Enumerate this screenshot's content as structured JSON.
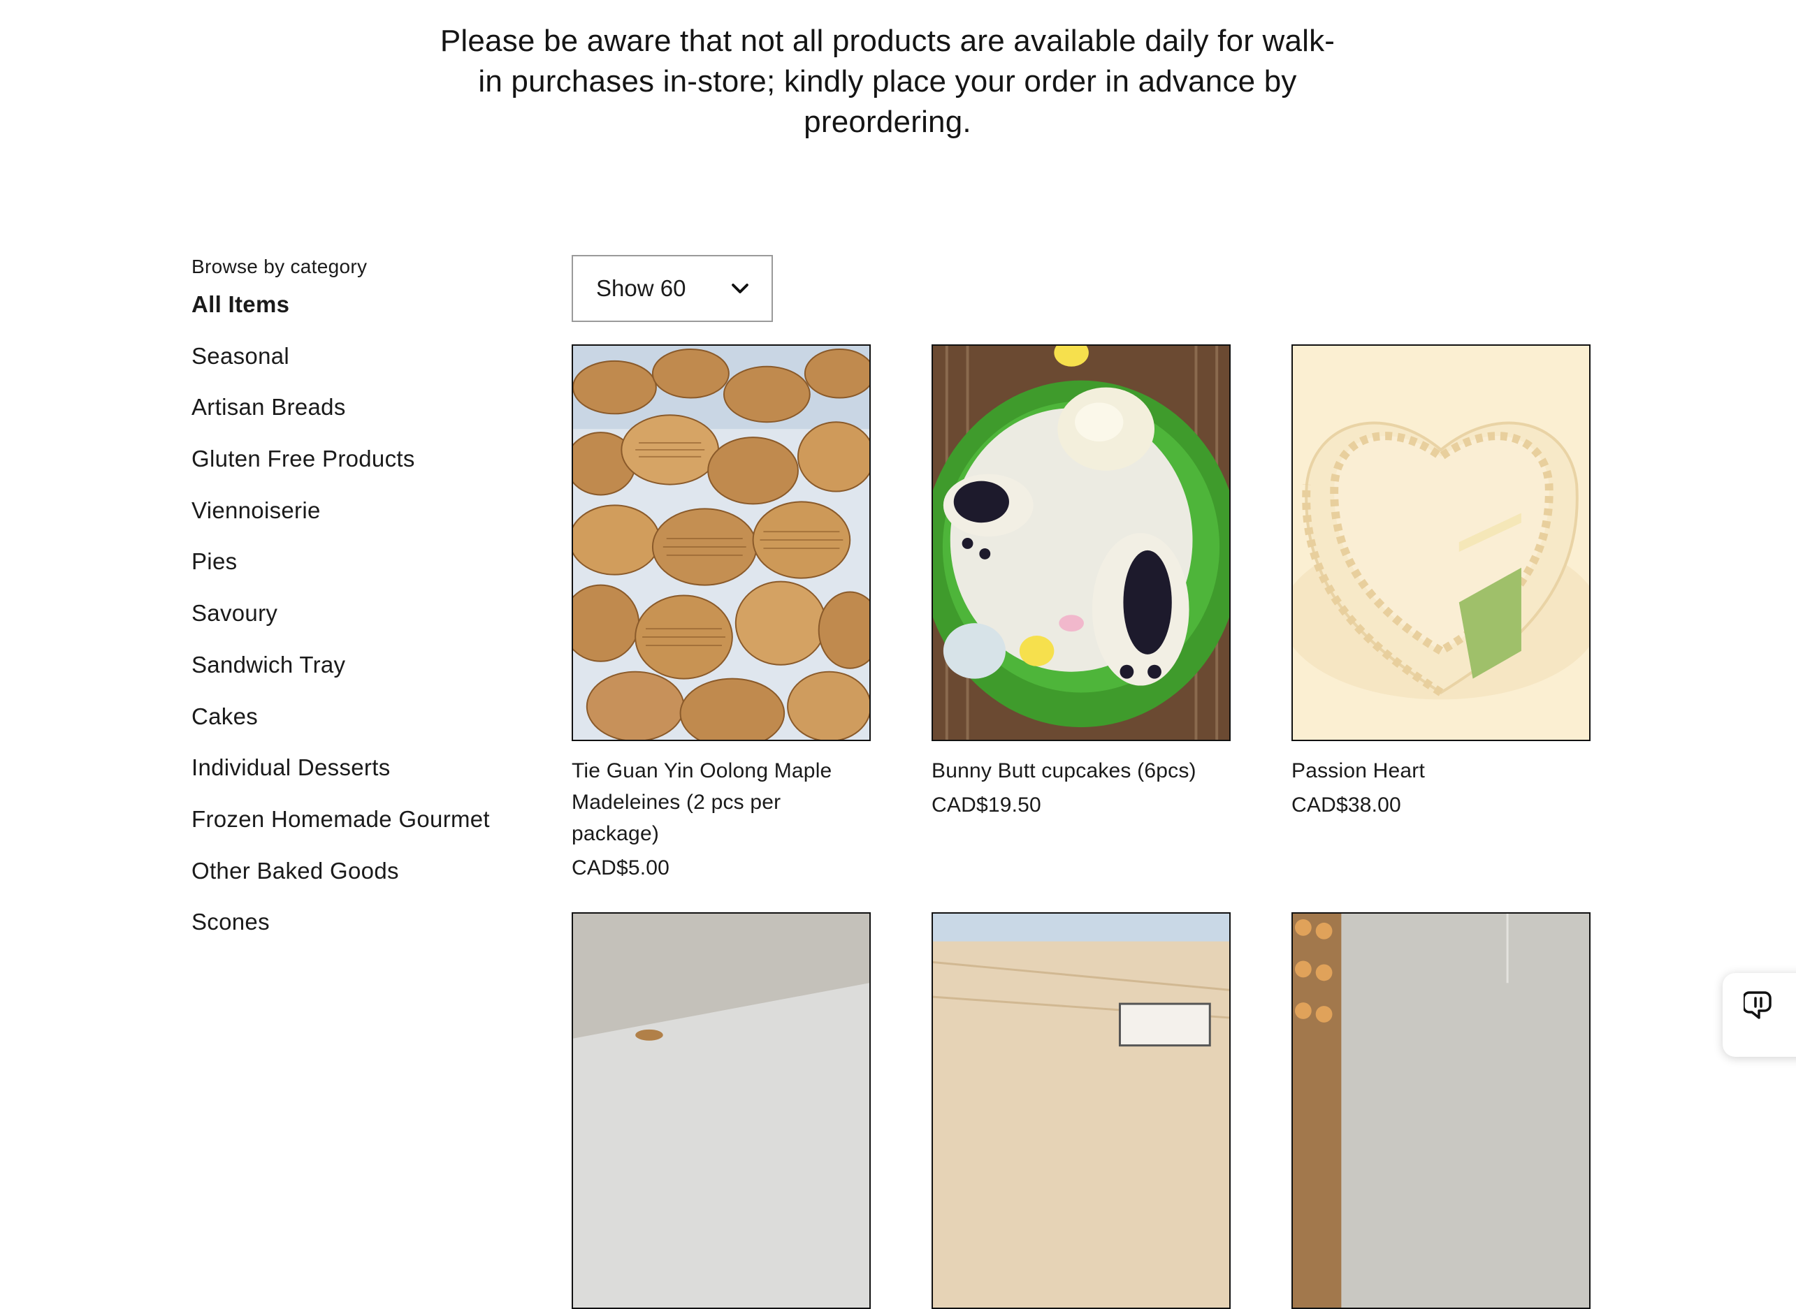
{
  "notice": {
    "line1": "Please be aware that not all products are available daily for walk-",
    "line2": "in purchases in-store; kindly place your order in advance by",
    "line3": "preordering."
  },
  "sidebar": {
    "heading": "Browse by category",
    "items": [
      {
        "label": "All Items",
        "active": true
      },
      {
        "label": "Seasonal"
      },
      {
        "label": "Artisan Breads"
      },
      {
        "label": "Gluten Free Products"
      },
      {
        "label": "Viennoiserie"
      },
      {
        "label": "Pies"
      },
      {
        "label": "Savoury"
      },
      {
        "label": "Sandwich Tray"
      },
      {
        "label": "Cakes"
      },
      {
        "label": "Individual Desserts"
      },
      {
        "label": "Frozen Homemade Gourmet"
      },
      {
        "label": "Other Baked Goods"
      },
      {
        "label": "Scones"
      }
    ]
  },
  "page_size": {
    "label": "Show 60",
    "icon": "chevron-down-icon"
  },
  "products": [
    {
      "name_line1": "Tie Guan Yin Oolong Maple",
      "name_line2": "Madeleines (2 pcs per package)",
      "price": "CAD$5.00"
    },
    {
      "name_line1": "Bunny Butt cupcakes (6pcs)",
      "name_line2": "",
      "price": "CAD$19.50"
    },
    {
      "name_line1": "Passion Heart",
      "name_line2": "",
      "price": "CAD$38.00"
    }
  ],
  "chat": {
    "icon": "chat-widget-icon"
  }
}
